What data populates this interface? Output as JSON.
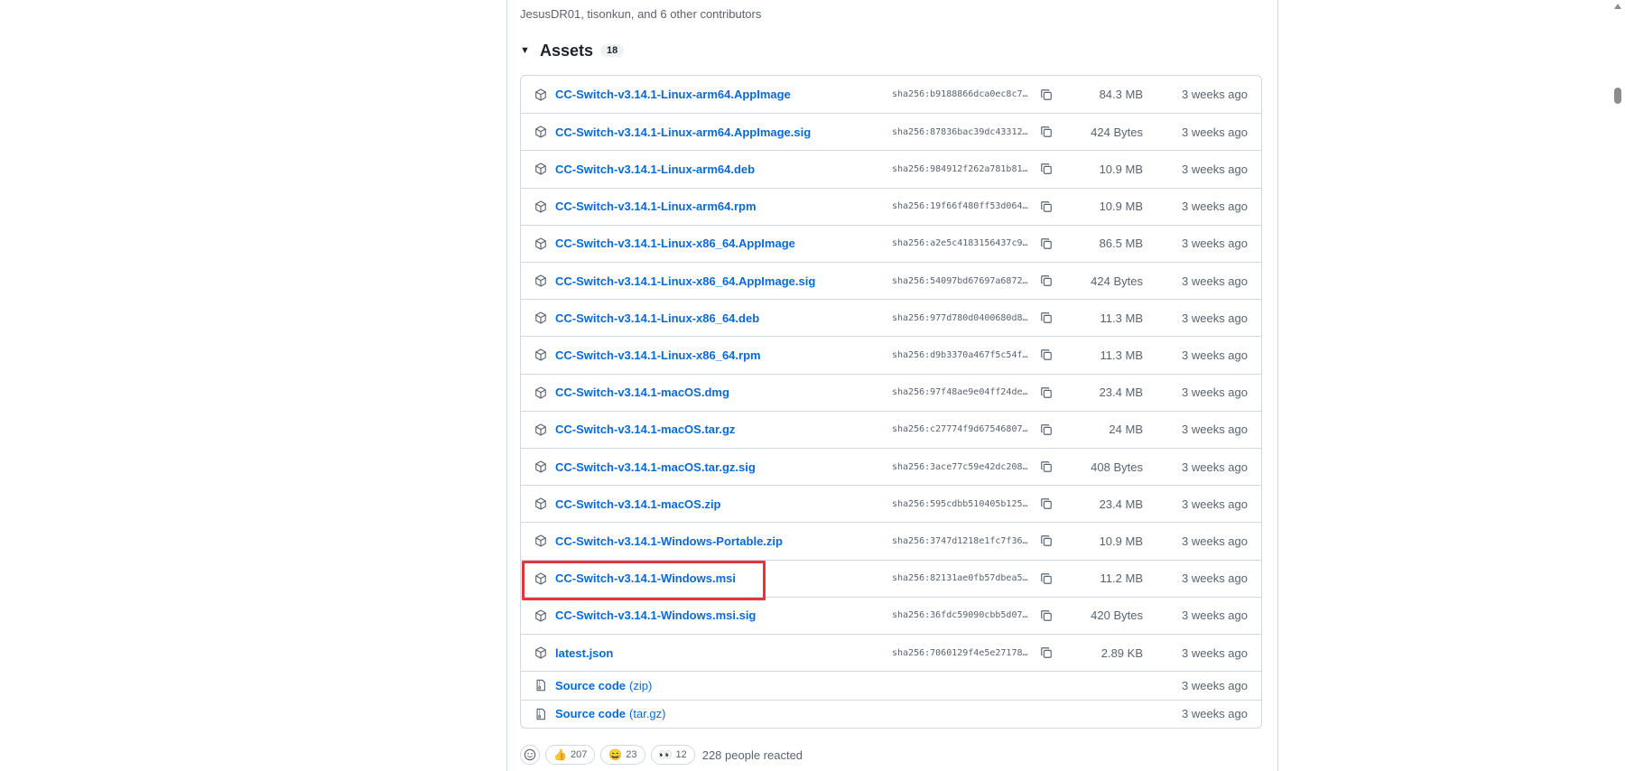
{
  "release": {
    "contributors_text": "JesusDR01, tisonkun, and 6 other contributors"
  },
  "assets": {
    "title": "Assets",
    "count": "18",
    "items": [
      {
        "name": "CC-Switch-v3.14.1-Linux-arm64.AppImage",
        "sha": "sha256:b9188866dca0ec8c7…",
        "size": "84.3 MB",
        "date": "3 weeks ago"
      },
      {
        "name": "CC-Switch-v3.14.1-Linux-arm64.AppImage.sig",
        "sha": "sha256:87836bac39dc43312…",
        "size": "424 Bytes",
        "date": "3 weeks ago"
      },
      {
        "name": "CC-Switch-v3.14.1-Linux-arm64.deb",
        "sha": "sha256:984912f262a781b81…",
        "size": "10.9 MB",
        "date": "3 weeks ago"
      },
      {
        "name": "CC-Switch-v3.14.1-Linux-arm64.rpm",
        "sha": "sha256:19f66f480ff53d064…",
        "size": "10.9 MB",
        "date": "3 weeks ago"
      },
      {
        "name": "CC-Switch-v3.14.1-Linux-x86_64.AppImage",
        "sha": "sha256:a2e5c4183156437c9…",
        "size": "86.5 MB",
        "date": "3 weeks ago"
      },
      {
        "name": "CC-Switch-v3.14.1-Linux-x86_64.AppImage.sig",
        "sha": "sha256:54097bd67697a6872…",
        "size": "424 Bytes",
        "date": "3 weeks ago"
      },
      {
        "name": "CC-Switch-v3.14.1-Linux-x86_64.deb",
        "sha": "sha256:977d780d0400680d8…",
        "size": "11.3 MB",
        "date": "3 weeks ago"
      },
      {
        "name": "CC-Switch-v3.14.1-Linux-x86_64.rpm",
        "sha": "sha256:d9b3370a467f5c54f…",
        "size": "11.3 MB",
        "date": "3 weeks ago"
      },
      {
        "name": "CC-Switch-v3.14.1-macOS.dmg",
        "sha": "sha256:97f48ae9e04ff24de…",
        "size": "23.4 MB",
        "date": "3 weeks ago"
      },
      {
        "name": "CC-Switch-v3.14.1-macOS.tar.gz",
        "sha": "sha256:c27774f9d67546807…",
        "size": "24 MB",
        "date": "3 weeks ago"
      },
      {
        "name": "CC-Switch-v3.14.1-macOS.tar.gz.sig",
        "sha": "sha256:3ace77c59e42dc208…",
        "size": "408 Bytes",
        "date": "3 weeks ago"
      },
      {
        "name": "CC-Switch-v3.14.1-macOS.zip",
        "sha": "sha256:595cdbb510405b125…",
        "size": "23.4 MB",
        "date": "3 weeks ago"
      },
      {
        "name": "CC-Switch-v3.14.1-Windows-Portable.zip",
        "sha": "sha256:3747d1218e1fc7f36…",
        "size": "10.9 MB",
        "date": "3 weeks ago"
      },
      {
        "name": "CC-Switch-v3.14.1-Windows.msi",
        "sha": "sha256:82131ae0fb57dbea5…",
        "size": "11.2 MB",
        "date": "3 weeks ago"
      },
      {
        "name": "CC-Switch-v3.14.1-Windows.msi.sig",
        "sha": "sha256:36fdc59090cbb5d07…",
        "size": "420 Bytes",
        "date": "3 weeks ago"
      },
      {
        "name": "latest.json",
        "sha": "sha256:7060129f4e5e27178…",
        "size": "2.89 KB",
        "date": "3 weeks ago"
      }
    ],
    "source_items": [
      {
        "name": "Source code",
        "suffix": "(zip)",
        "date": "3 weeks ago"
      },
      {
        "name": "Source code",
        "suffix": "(tar.gz)",
        "date": "3 weeks ago"
      }
    ]
  },
  "reactions": {
    "items": [
      {
        "icon": "thumbs-up-icon",
        "emoji": "👍",
        "count": "207"
      },
      {
        "icon": "laugh-icon",
        "emoji": "😄",
        "count": "23"
      },
      {
        "icon": "eyes-icon",
        "emoji": "👀",
        "count": "12"
      }
    ],
    "summary": "228 people reacted"
  },
  "highlight": {
    "target": "CC-Switch-v3.14.1-Windows.msi",
    "color": "#e5343b"
  },
  "colors": {
    "link": "#0969da",
    "muted": "#59636e",
    "border": "#d1d9e0"
  }
}
